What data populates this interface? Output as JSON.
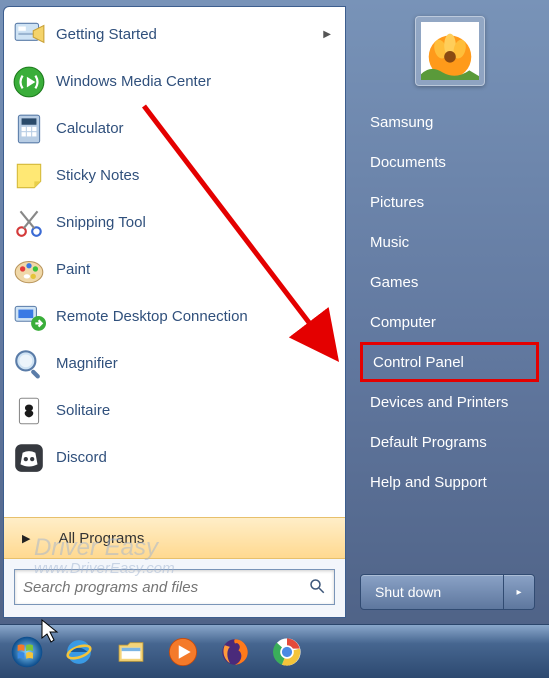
{
  "programs": [
    {
      "label": "Getting Started",
      "has_arrow": true,
      "icon": "getting-started"
    },
    {
      "label": "Windows Media Center",
      "has_arrow": false,
      "icon": "wmc"
    },
    {
      "label": "Calculator",
      "has_arrow": false,
      "icon": "calculator"
    },
    {
      "label": "Sticky Notes",
      "has_arrow": false,
      "icon": "sticky-notes"
    },
    {
      "label": "Snipping Tool",
      "has_arrow": false,
      "icon": "snipping-tool"
    },
    {
      "label": "Paint",
      "has_arrow": false,
      "icon": "paint"
    },
    {
      "label": "Remote Desktop Connection",
      "has_arrow": false,
      "icon": "rdp"
    },
    {
      "label": "Magnifier",
      "has_arrow": false,
      "icon": "magnifier"
    },
    {
      "label": "Solitaire",
      "has_arrow": false,
      "icon": "solitaire"
    },
    {
      "label": "Discord",
      "has_arrow": false,
      "icon": "discord"
    }
  ],
  "all_programs": {
    "label": "All Programs"
  },
  "search": {
    "placeholder": "Search programs and files"
  },
  "user": {
    "name": "Samsung"
  },
  "right_items": [
    {
      "label": "Samsung",
      "highlight": false
    },
    {
      "label": "Documents",
      "highlight": false
    },
    {
      "label": "Pictures",
      "highlight": false
    },
    {
      "label": "Music",
      "highlight": false
    },
    {
      "label": "Games",
      "highlight": false
    },
    {
      "label": "Computer",
      "highlight": false
    },
    {
      "label": "Control Panel",
      "highlight": true
    },
    {
      "label": "Devices and Printers",
      "highlight": false
    },
    {
      "label": "Default Programs",
      "highlight": false
    },
    {
      "label": "Help and Support",
      "highlight": false
    }
  ],
  "shutdown": {
    "label": "Shut down"
  },
  "taskbar_icons": [
    {
      "name": "start-orb"
    },
    {
      "name": "internet-explorer"
    },
    {
      "name": "file-explorer"
    },
    {
      "name": "windows-media-player"
    },
    {
      "name": "firefox"
    },
    {
      "name": "chrome"
    }
  ],
  "watermark": {
    "line1": "Driver Easy",
    "line2": "www.DriverEasy.com"
  },
  "annotation": {
    "highlight_target": "Control Panel",
    "color": "#e40000"
  }
}
